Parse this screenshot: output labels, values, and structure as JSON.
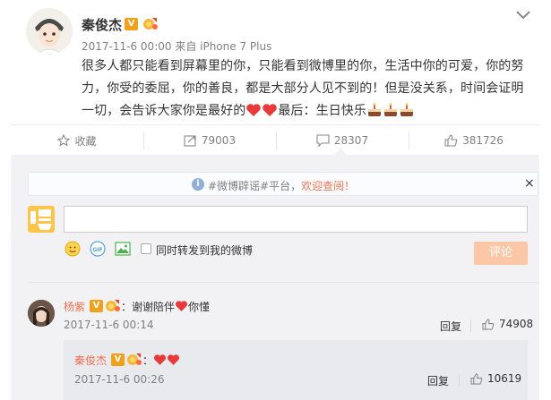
{
  "post": {
    "author": "秦俊杰",
    "meta": "2017-11-6 00:00 来自 iPhone 7 Plus",
    "text_lines": [
      "很多人都只能看到屏幕里的你，只能看到微博里的你，生活中你的可爱，你的努",
      "力，你受的委屈，你的善良，都是大部分人见不到的！但是没关系，时间会证明",
      "一切，会告诉大家你是最好的",
      "最后：生日快乐"
    ],
    "verified_badge": "V"
  },
  "actions": {
    "favorite_label": "收藏",
    "repost_count": "79003",
    "comment_count": "28307",
    "like_count": "381726"
  },
  "notice": {
    "prefix": "#微博辟谣#平台，",
    "link": "欢迎查阅！",
    "close": "×"
  },
  "composer": {
    "input_value": "",
    "repost_label": "同时转发到我的微博",
    "submit_label": "评论"
  },
  "comments": [
    {
      "author": "杨紫",
      "text_before": "：谢谢陪伴",
      "text_after": "你懂",
      "time": "2017-11-6 00:14",
      "reply_label": "回复",
      "likes": "74908",
      "reply": {
        "author": "秦俊杰",
        "text": "：",
        "time": "2017-11-6 00:26",
        "reply_label": "回复",
        "likes": "10619"
      }
    }
  ],
  "colors": {
    "accent": "#eb7350",
    "vip_badge": "#f0a11c",
    "heart": "#e83a3a",
    "submit_disabled": "#fcc7a6"
  }
}
